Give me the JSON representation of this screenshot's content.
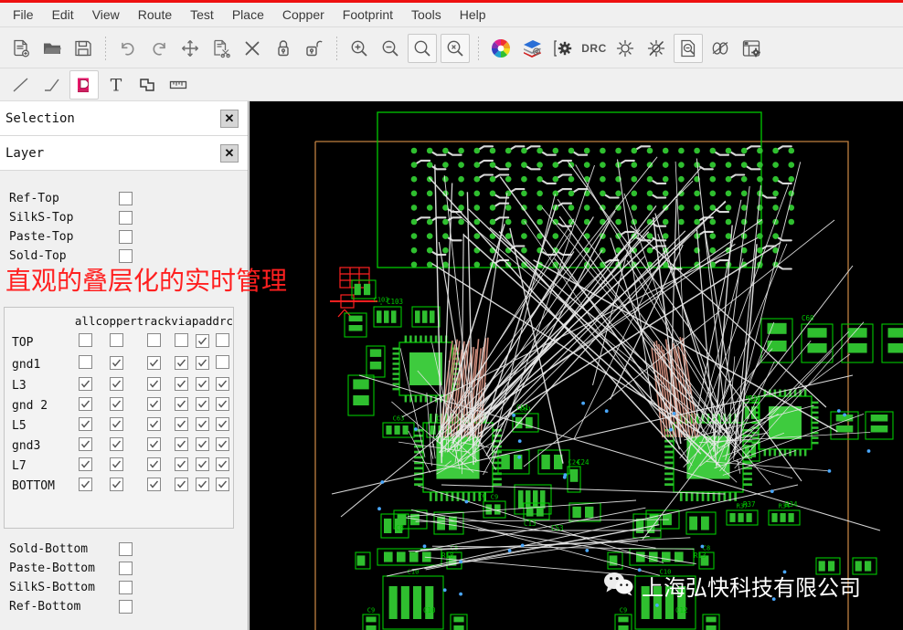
{
  "window": {
    "accent_color": "#ee1111"
  },
  "menubar": {
    "items": [
      {
        "label": "File"
      },
      {
        "label": "Edit"
      },
      {
        "label": "View"
      },
      {
        "label": "Route"
      },
      {
        "label": "Test"
      },
      {
        "label": "Place"
      },
      {
        "label": "Copper"
      },
      {
        "label": "Footprint"
      },
      {
        "label": "Tools"
      },
      {
        "label": "Help"
      }
    ]
  },
  "toolbar_main": {
    "groups": [
      {
        "buttons": [
          {
            "icon": "new-file-icon",
            "tooltip": "New"
          },
          {
            "icon": "open-folder-icon",
            "tooltip": "Open"
          },
          {
            "icon": "save-icon",
            "tooltip": "Save"
          }
        ]
      },
      {
        "buttons": [
          {
            "icon": "undo-icon",
            "tooltip": "Undo"
          },
          {
            "icon": "redo-icon",
            "tooltip": "Redo"
          },
          {
            "icon": "move-icon",
            "tooltip": "Move"
          },
          {
            "icon": "cut-icon",
            "tooltip": "Cut"
          },
          {
            "icon": "delete-icon",
            "tooltip": "Delete"
          },
          {
            "icon": "lock-icon",
            "tooltip": "Lock"
          },
          {
            "icon": "unlock-icon",
            "tooltip": "Unlock"
          }
        ]
      },
      {
        "buttons": [
          {
            "icon": "zoom-in-icon",
            "tooltip": "Zoom In"
          },
          {
            "icon": "zoom-out-icon",
            "tooltip": "Zoom Out"
          },
          {
            "icon": "zoom-fit-icon",
            "tooltip": "Zoom Fit"
          },
          {
            "icon": "zoom-cancel-icon",
            "tooltip": "Zoom Cancel"
          }
        ]
      },
      {
        "buttons": [
          {
            "icon": "color-wheel-icon",
            "tooltip": "Colors"
          },
          {
            "icon": "layer-stack-icon",
            "tooltip": "Layer Stack"
          },
          {
            "icon": "settings-gear-icon",
            "tooltip": "Settings"
          },
          {
            "icon": "drc-text-icon",
            "label": "DRC",
            "tooltip": "Design Rule Check"
          },
          {
            "icon": "brightness-on-icon",
            "tooltip": "Highlight On"
          },
          {
            "icon": "brightness-off-icon",
            "tooltip": "Highlight Off"
          },
          {
            "icon": "document-search-icon",
            "tooltip": "Find"
          },
          {
            "icon": "ratsnest-icon",
            "tooltip": "Ratsnest"
          },
          {
            "icon": "panel-config-icon",
            "tooltip": "Panels"
          }
        ]
      }
    ]
  },
  "toolbar_draw": {
    "buttons": [
      {
        "icon": "line-icon",
        "tooltip": "Line",
        "active": false
      },
      {
        "icon": "polyline-icon",
        "tooltip": "Polyline",
        "active": false
      },
      {
        "icon": "dimension-d-icon",
        "label": "D",
        "tooltip": "Dimension",
        "active": true
      },
      {
        "icon": "text-icon",
        "label": "T",
        "tooltip": "Text",
        "active": false
      },
      {
        "icon": "polygon-icon",
        "tooltip": "Polygon",
        "active": false
      },
      {
        "icon": "ruler-icon",
        "tooltip": "Measure",
        "active": false
      }
    ]
  },
  "panels": {
    "selection": {
      "title": "Selection",
      "close_label": "✕"
    },
    "layer": {
      "title": "Layer",
      "close_label": "✕"
    }
  },
  "layer_panel": {
    "top_layers": [
      {
        "name": "Ref-Top",
        "checked": false
      },
      {
        "name": "SilkS-Top",
        "checked": false
      },
      {
        "name": "Paste-Top",
        "checked": false
      },
      {
        "name": "Sold-Top",
        "checked": false
      }
    ],
    "matrix": {
      "columns": [
        "all",
        "copper",
        "track",
        "via",
        "pad",
        "drc"
      ],
      "rows": [
        {
          "name": "TOP",
          "values": [
            false,
            false,
            false,
            false,
            true,
            false
          ]
        },
        {
          "name": "gnd1",
          "values": [
            false,
            true,
            true,
            true,
            true,
            false
          ]
        },
        {
          "name": "L3",
          "values": [
            true,
            true,
            true,
            true,
            true,
            true
          ]
        },
        {
          "name": "gnd 2",
          "values": [
            true,
            true,
            true,
            true,
            true,
            true
          ]
        },
        {
          "name": "L5",
          "values": [
            true,
            true,
            true,
            true,
            true,
            true
          ]
        },
        {
          "name": "gnd3",
          "values": [
            true,
            true,
            true,
            true,
            true,
            true
          ]
        },
        {
          "name": "L7",
          "values": [
            true,
            true,
            true,
            true,
            true,
            true
          ]
        },
        {
          "name": "BOTTOM",
          "values": [
            true,
            true,
            true,
            true,
            true,
            true
          ]
        }
      ]
    },
    "bottom_layers": [
      {
        "name": "Sold-Bottom",
        "checked": false
      },
      {
        "name": "Paste-Bottom",
        "checked": false
      },
      {
        "name": "SilkS-Bottom",
        "checked": false
      },
      {
        "name": "Ref-Bottom",
        "checked": false
      }
    ]
  },
  "annotation": {
    "text": "直观的叠层化的实时管理",
    "color": "#ff2020"
  },
  "watermark": {
    "icon": "wechat-icon",
    "text": "上海弘快科技有限公司",
    "color": "#ffffff"
  },
  "canvas": {
    "background": "#000000",
    "board_outline_color": "#c08040",
    "silkscreen_color": "#00c800",
    "pad_color": "#2fbf2f",
    "ratsnest_color": "#e8e8e8",
    "highlight_color": "#c88878",
    "component_labels": [
      "C103",
      "C61",
      "C24",
      "C9",
      "C8",
      "C10",
      "C12",
      "C13",
      "R30",
      "R37",
      "R34",
      "R18",
      "R13",
      "C53",
      "C60"
    ]
  }
}
